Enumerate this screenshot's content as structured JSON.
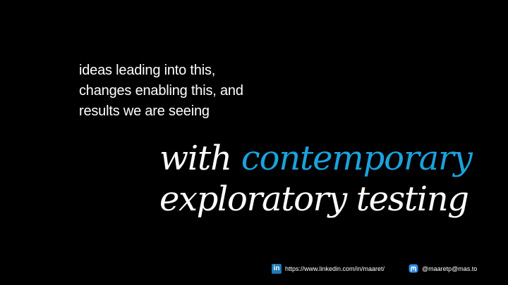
{
  "intro_lines": [
    "ideas leading into this,",
    "changes enabling this, and",
    "results we are seeing"
  ],
  "headline": {
    "part1": "with",
    "part2": "contemporary",
    "line2": "exploratory testing"
  },
  "footer": {
    "linkedin_icon_text": "in",
    "linkedin_url": "https://www.linkedin.com/in/maaret/",
    "mastodon_handle": "@maaretp@mas.to"
  },
  "colors": {
    "background": "#000000",
    "text": "#ffffff",
    "accent": "#1aa3dc",
    "linkedin": "#1d7ab7",
    "mastodon": "#2f8ce8"
  },
  "icons": [
    "linkedin-icon",
    "mastodon-icon"
  ]
}
